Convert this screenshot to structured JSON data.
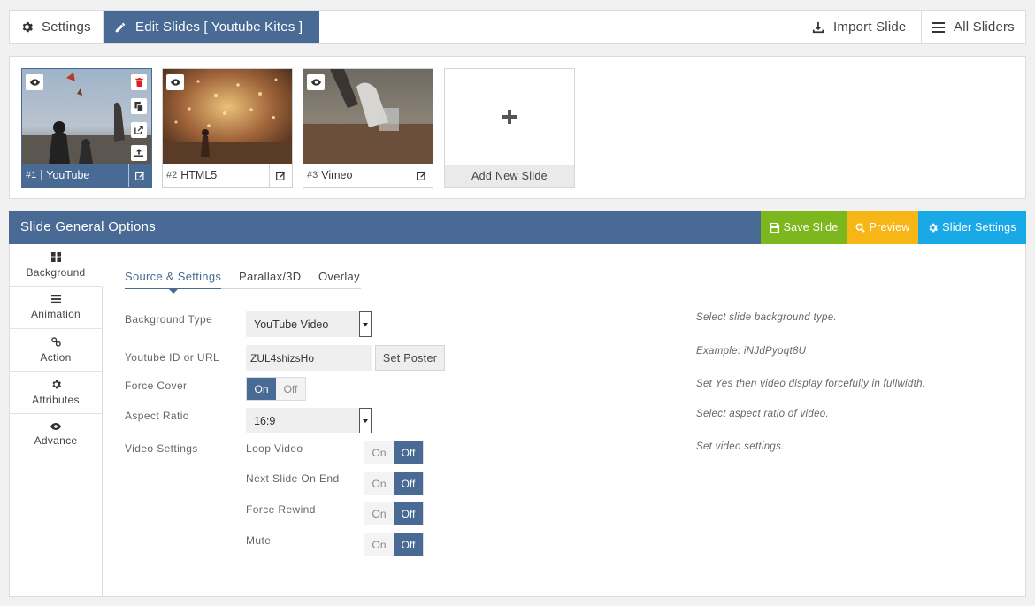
{
  "topbar": {
    "settings_label": "Settings",
    "edit_label": "Edit Slides [ Youtube Kites ]",
    "import_label": "Import Slide",
    "all_label": "All Sliders"
  },
  "slides": [
    {
      "num": "#1",
      "name": "YouTube"
    },
    {
      "num": "#2",
      "name": "HTML5"
    },
    {
      "num": "#3",
      "name": "Vimeo"
    }
  ],
  "add_slide_label": "Add New Slide",
  "panel": {
    "title": "Slide General Options",
    "save_label": "Save Slide",
    "preview_label": "Preview",
    "slider_settings_label": "Slider Settings"
  },
  "sidenav": [
    {
      "label": "Background",
      "icon": "grid-icon"
    },
    {
      "label": "Animation",
      "icon": "bars-icon"
    },
    {
      "label": "Action",
      "icon": "link-icon"
    },
    {
      "label": "Attributes",
      "icon": "gear-icon"
    },
    {
      "label": "Advance",
      "icon": "eye-icon"
    }
  ],
  "subtabs": [
    "Source & Settings",
    "Parallax/3D",
    "Overlay"
  ],
  "form": {
    "bg_type_label": "Background Type",
    "bg_type_value": "YouTube Video",
    "bg_type_help": "Select slide background type.",
    "yt_label": "Youtube ID or URL",
    "yt_value": "ZUL4shizsHo",
    "yt_help": "Example: iNJdPyoqt8U",
    "set_poster_label": "Set Poster",
    "force_cover_label": "Force Cover",
    "force_cover_help": "Set Yes then video display forcefully in fullwidth.",
    "aspect_label": "Aspect Ratio",
    "aspect_value": "16:9",
    "aspect_help": "Select aspect ratio of video.",
    "video_settings_label": "Video Settings",
    "video_settings_help": "Set video settings.",
    "loop_label": "Loop Video",
    "next_label": "Next Slide On End",
    "rewind_label": "Force Rewind",
    "mute_label": "Mute",
    "on_label": "On",
    "off_label": "Off"
  },
  "colors": {
    "accent": "#486a94",
    "save": "#7cb71d",
    "preview": "#f5b616",
    "slider_settings": "#19a9e6",
    "delete_icon": "#e02020"
  }
}
